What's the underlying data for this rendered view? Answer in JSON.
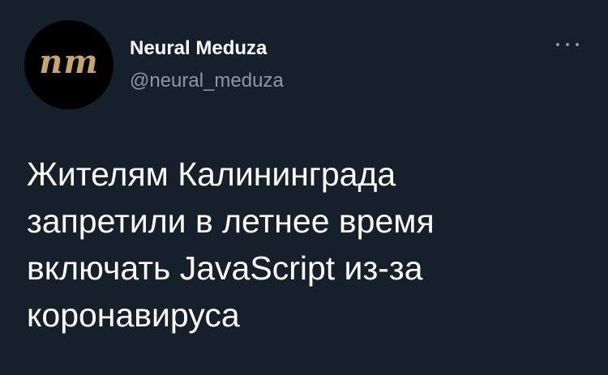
{
  "tweet": {
    "avatar_text": "nm",
    "display_name": "Neural Meduza",
    "handle": "@neural_meduza",
    "more_icon": "more-horizontal-icon",
    "text": "Жителям Калининграда\nзапретили в летнее время\nвключать JavaScript из-за\nкоронавируса"
  },
  "colors": {
    "background": "#15202b",
    "text": "#ffffff",
    "secondary_text": "#8b98a5",
    "avatar_bg": "#000000",
    "avatar_mark": "#c8a56b"
  }
}
